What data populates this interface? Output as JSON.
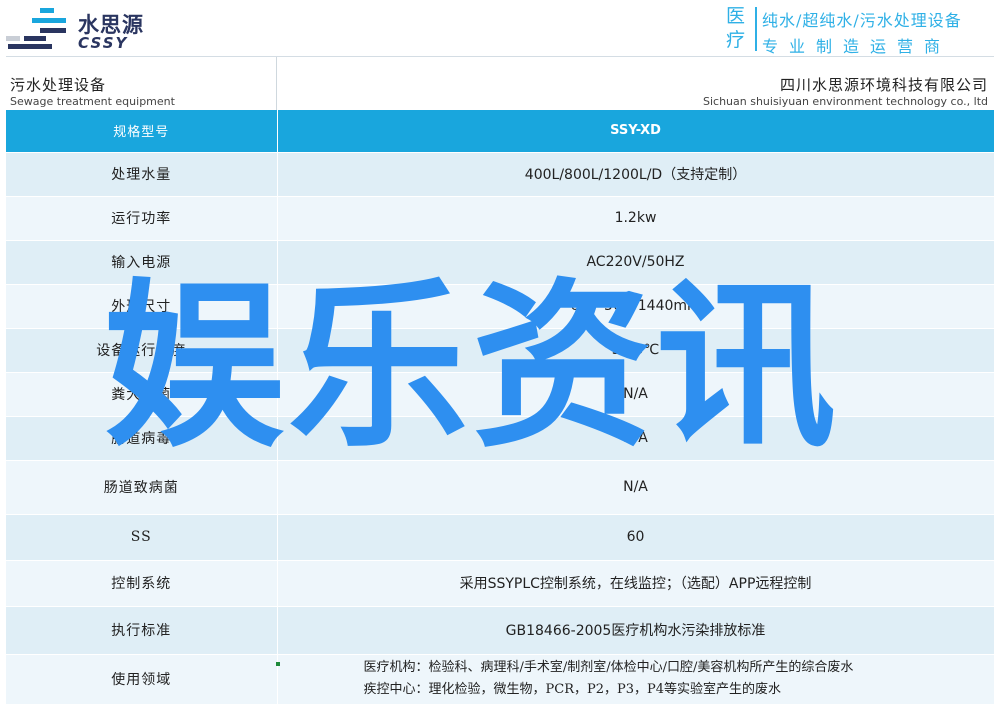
{
  "brand": {
    "name_cn": "水思源",
    "name_en": "CSSY",
    "color": "#2a3560"
  },
  "slogan": {
    "side_chars": [
      "医",
      "疗"
    ],
    "line1": "纯水/超纯水/污水处理设备",
    "line2": "专业制造运营商",
    "color": "#2fb0e6"
  },
  "subheader": {
    "left_cn": "污水处理设备",
    "left_en": "Sewage treatment equipment",
    "right_cn": "四川水思源环境科技有限公司",
    "right_en": "Sichuan shuisiyuan environment technology co., ltd"
  },
  "table": {
    "header": {
      "label": "规格型号",
      "value": "SSY-XD",
      "color": "#19a6dd"
    },
    "rows": [
      {
        "label": "处理水量",
        "value": "400L/800L/1200L/D（支持定制）"
      },
      {
        "label": "运行功率",
        "value": "1.2kw"
      },
      {
        "label": "输入电源",
        "value": "AC220V/50HZ"
      },
      {
        "label": "外形尺寸",
        "value": "680*560*1440mm"
      },
      {
        "label": "设备运行温度",
        "value": "5-40℃"
      },
      {
        "label": "粪大肠菌",
        "value": "N/A"
      },
      {
        "label": "肠道病毒",
        "value": "N/A"
      },
      {
        "label": "肠道致病菌",
        "value": "N/A"
      },
      {
        "label": "SS",
        "value": "60"
      },
      {
        "label": "控制系统",
        "value": "采用SSYPLC控制系统，在线监控；（选配）APP远程控制"
      },
      {
        "label": "执行标准",
        "value": "GB18466-2005医疗机构水污染排放标准"
      },
      {
        "label": "使用领域",
        "value_lines": [
          "医疗机构：检验科、病理科/手术室/制剂室/体检中心/口腔/美容机构所产生的综合废水",
          "疾控中心：理化检验，微生物，PCR，P2，P3，P4等实验室产生的废水"
        ]
      }
    ]
  },
  "overlay": {
    "text": "娱乐资讯",
    "color": "#2e8ff0"
  }
}
